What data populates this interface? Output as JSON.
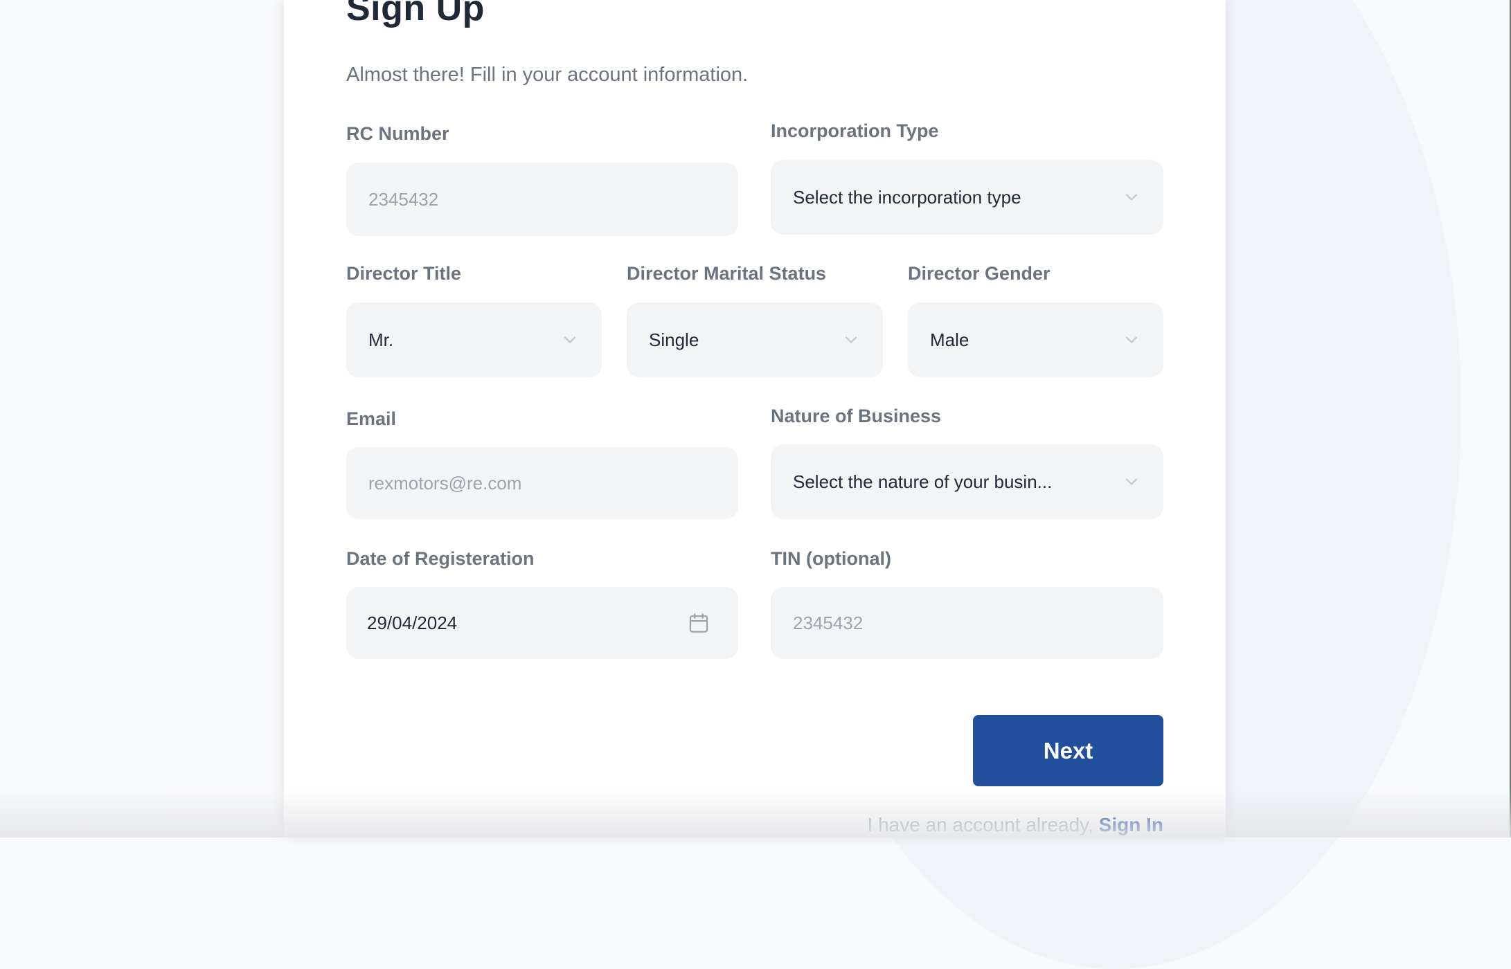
{
  "page": {
    "title": "Sign Up",
    "subtitle": "Almost there! Fill in your account information."
  },
  "form": {
    "rc_number": {
      "label": "RC Number",
      "placeholder": "2345432",
      "value": ""
    },
    "incorporation_type": {
      "label": "Incorporation Type",
      "selected": "Select the incorporation type"
    },
    "director_title": {
      "label": "Director Title",
      "selected": "Mr."
    },
    "director_marital_status": {
      "label": "Director Marital Status",
      "selected": "Single"
    },
    "director_gender": {
      "label": "Director Gender",
      "selected": "Male"
    },
    "email": {
      "label": "Email",
      "placeholder": "rexmotors@re.com",
      "value": ""
    },
    "nature_of_business": {
      "label": "Nature of Business",
      "selected": "Select the nature of your busin..."
    },
    "date_of_registration": {
      "label": "Date of Registeration",
      "value": "29/04/2024"
    },
    "tin": {
      "label": "TIN (optional)",
      "placeholder": "2345432",
      "value": ""
    }
  },
  "actions": {
    "next_label": "Next",
    "signin_prompt": "I have an account already,",
    "signin_link": "Sign In"
  },
  "icons": {
    "select_chevron": "chevron-down-icon",
    "date_picker": "calendar-icon"
  },
  "colors": {
    "primary": "#224f9c",
    "title": "#1f2937",
    "label": "#6b7280",
    "input_bg": "#f3f4f6",
    "placeholder": "#9ca3af"
  }
}
